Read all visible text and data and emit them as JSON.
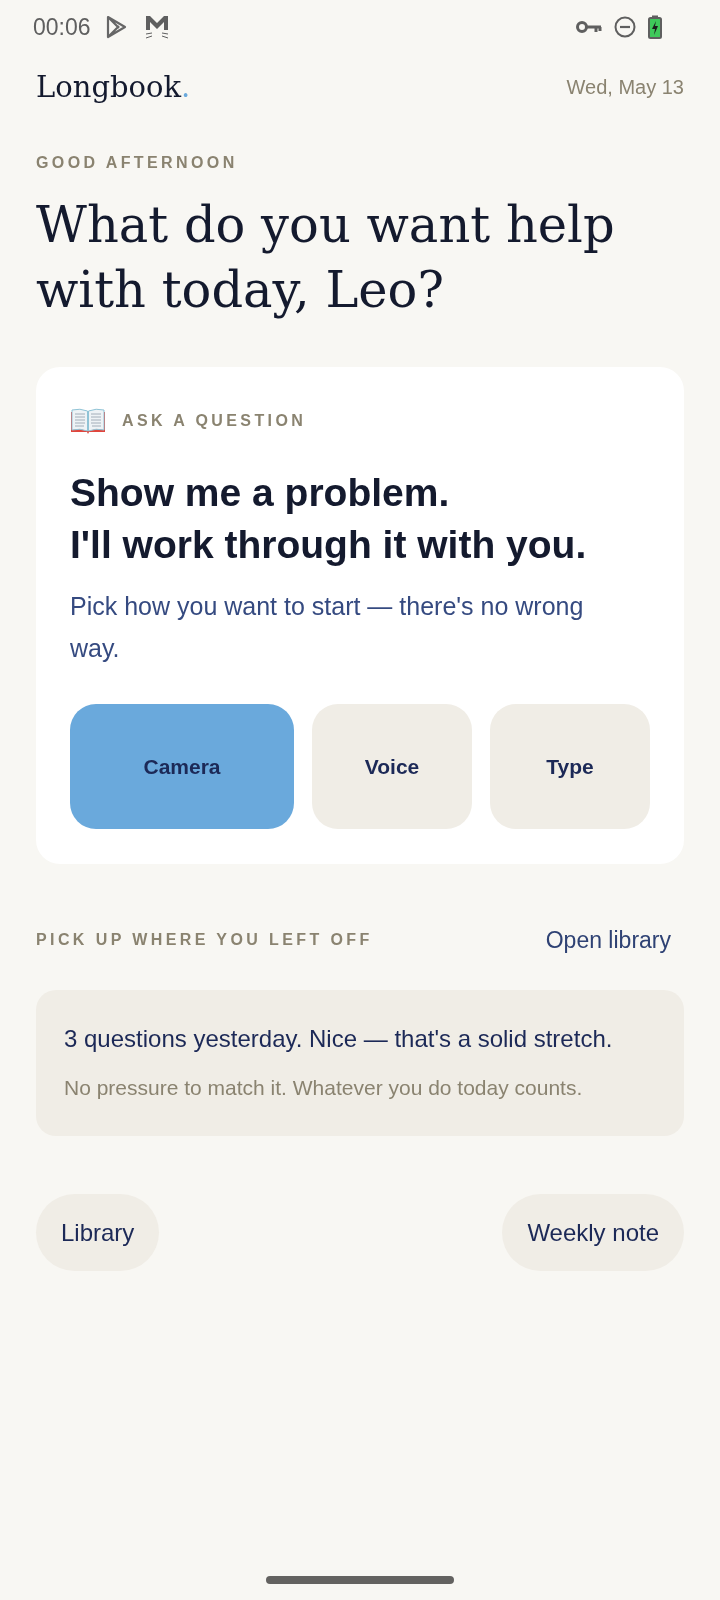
{
  "status_bar": {
    "time": "00:06"
  },
  "header": {
    "logo": {
      "word": "Longbook",
      "dot": "."
    },
    "date": "Wed, May 13"
  },
  "greeting": {
    "eyebrow": "GOOD AFTERNOON",
    "headline": "What do you want help with today, Leo?"
  },
  "ask_card": {
    "eyebrow": "ASK A QUESTION",
    "title_lines": [
      "Show me a problem.",
      "I'll work through it with you."
    ],
    "subtitle": "Pick how you want to start — there's no wrong way.",
    "modes": [
      {
        "label": "Camera",
        "selected": true
      },
      {
        "label": "Voice",
        "selected": false
      },
      {
        "label": "Type",
        "selected": false
      }
    ]
  },
  "resume": {
    "heading": "PICK UP WHERE YOU LEFT OFF",
    "link": "Open library",
    "summary": {
      "title": "3 questions yesterday. Nice — that's a solid stretch.",
      "note": "No pressure to match it. Whatever you do today counts."
    }
  },
  "footer_buttons": [
    "Library",
    "Weekly note"
  ]
}
